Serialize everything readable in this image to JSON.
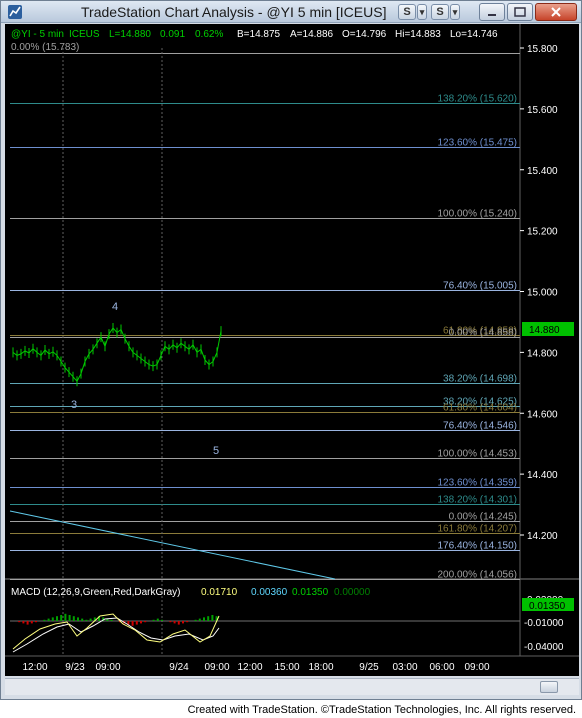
{
  "window": {
    "title": "TradeStation Chart Analysis - @YI 5 min [ICEUS]",
    "symbol_button_s": "S",
    "symbol_button_arrow": "▾"
  },
  "header": {
    "symbol": "@YI - 5 min",
    "exchange": "ICEUS",
    "last": "L=14.880",
    "change": "0.091",
    "change_pct": "0.62%",
    "bid": "B=14.875",
    "ask": "A=14.886",
    "open": "O=14.796",
    "high": "Hi=14.883",
    "low": "Lo=14.746",
    "top_fib_label": "0.00% (15.783)"
  },
  "price_axis": {
    "ticks": [
      "15.800",
      "15.600",
      "15.400",
      "15.200",
      "15.000",
      "14.800",
      "14.600",
      "14.400",
      "14.200"
    ],
    "current_price": "14.880"
  },
  "fib_levels": [
    {
      "label": "0.00% (15.783)",
      "value": 15.783,
      "color": "#a0a0a0"
    },
    {
      "label": "138.20% (15.620)",
      "value": 15.62,
      "color": "#2e8b8b"
    },
    {
      "label": "123.60% (15.475)",
      "value": 15.475,
      "color": "#6e8fcf"
    },
    {
      "label": "100.00% (15.240)",
      "value": 15.24,
      "color": "#a0a0a0"
    },
    {
      "label": "76.40% (15.005)",
      "value": 15.005,
      "color": "#9ab4e0"
    },
    {
      "label": "61.80% (14.858)",
      "value": 14.858,
      "color": "#8b7b3a"
    },
    {
      "label": "0.00% (14.858)",
      "value": 14.849,
      "color": "#a0a0a0"
    },
    {
      "label": "38.20% (14.698)",
      "value": 14.698,
      "color": "#5fa6b6"
    },
    {
      "label": "38.20% (14.625)",
      "value": 14.625,
      "color": "#5fa6b6"
    },
    {
      "label": "61.80% (14.604)",
      "value": 14.604,
      "color": "#8b7b3a"
    },
    {
      "label": "76.40% (14.546)",
      "value": 14.546,
      "color": "#9ab4e0"
    },
    {
      "label": "100.00% (14.453)",
      "value": 14.453,
      "color": "#a0a0a0"
    },
    {
      "label": "123.60% (14.359)",
      "value": 14.359,
      "color": "#6e8fcf"
    },
    {
      "label": "138.20% (14.301)",
      "value": 14.301,
      "color": "#2e8b8b"
    },
    {
      "label": "0.00% (14.245)",
      "value": 14.245,
      "color": "#a0a0a0"
    },
    {
      "label": "161.80% (14.207)",
      "value": 14.207,
      "color": "#8b7b3a"
    },
    {
      "label": "176.40% (14.150)",
      "value": 14.15,
      "color": "#9ab4e0"
    },
    {
      "label": "200.00% (14.056)",
      "value": 14.056,
      "color": "#a0a0a0"
    }
  ],
  "wave_labels": [
    "4",
    "3",
    "5"
  ],
  "macd": {
    "title": "MACD (12,26,9,Green,Red,DarkGray)",
    "macd": "0.01710",
    "signal": "0.00360",
    "diff": "0.01350",
    "zero": "0.00000",
    "axis_ticks": [
      "0.02000",
      "-0.01000",
      "-0.04000"
    ],
    "current": "0.01350"
  },
  "time_axis": {
    "ticks": [
      "12:00",
      "9/23",
      "09:00",
      "9/24",
      "09:00",
      "12:00",
      "15:00",
      "18:00",
      "9/25",
      "03:00",
      "06:00",
      "09:00"
    ]
  },
  "colors": {
    "background": "#000000",
    "price_bars": "#00c800",
    "macd_line": "#ffff80",
    "signal_line": "#ffffff",
    "hist_pos": "#00a000",
    "hist_neg": "#d00000",
    "trendline": "#5fc8e8",
    "price_tag": "#00c000"
  },
  "footer": {
    "credit": "Created with TradeStation. ©TradeStation Technologies, Inc. All rights reserved."
  }
}
